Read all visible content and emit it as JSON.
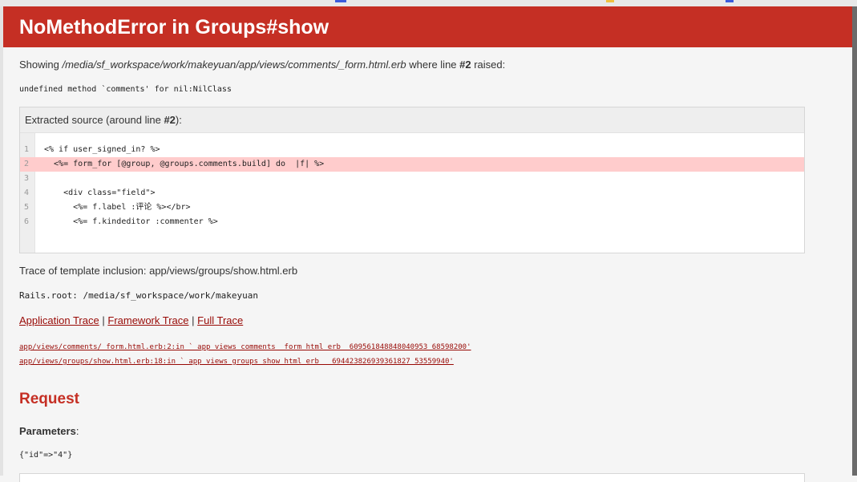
{
  "page": {
    "title": "NoMethodError in Groups#show"
  },
  "showing": {
    "prefix": "Showing ",
    "path": "/media/sf_workspace/work/makeyuan/app/views/comments/_form.html.erb",
    "middle": " where line ",
    "line": "#2",
    "suffix": " raised:"
  },
  "error_message": "undefined method `comments' for nil:NilClass",
  "source": {
    "header_prefix": "Extracted source (around line ",
    "header_line": "#2",
    "header_suffix": "):",
    "lines": [
      {
        "num": "1",
        "text": "<% if user_signed_in? %>"
      },
      {
        "num": "2",
        "text": "  <%= form_for [@group, @groups.comments.build] do  |f| %>"
      },
      {
        "num": "3",
        "text": ""
      },
      {
        "num": "4",
        "text": "    <div class=\"field\">"
      },
      {
        "num": "5",
        "text": "      <%= f.label :评论 %></br>"
      },
      {
        "num": "6",
        "text": "      <%= f.kindeditor :commenter %>"
      }
    ],
    "highlight_line": "2"
  },
  "trace_inclusion": "Trace of template inclusion: app/views/groups/show.html.erb",
  "rails_root": "Rails.root: /media/sf_workspace/work/makeyuan",
  "trace_links": {
    "application": "Application Trace",
    "framework": "Framework Trace",
    "full": "Full Trace",
    "separator": "|"
  },
  "trace_lines": [
    "app/views/comments/_form.html.erb:2:in `_app_views_comments__form_html_erb__609561848848040953_68598200'",
    "app/views/groups/show.html.erb:18:in `_app_views_groups_show_html_erb___694423826939361827_53559940'"
  ],
  "request": {
    "heading": "Request",
    "params_label": "Parameters",
    "params_colon": ":",
    "params_value": "{\"id\"=>\"4\"}"
  },
  "colors": {
    "header_bg": "#c52f24",
    "link": "#980905",
    "highlight": "#ffcccc"
  }
}
